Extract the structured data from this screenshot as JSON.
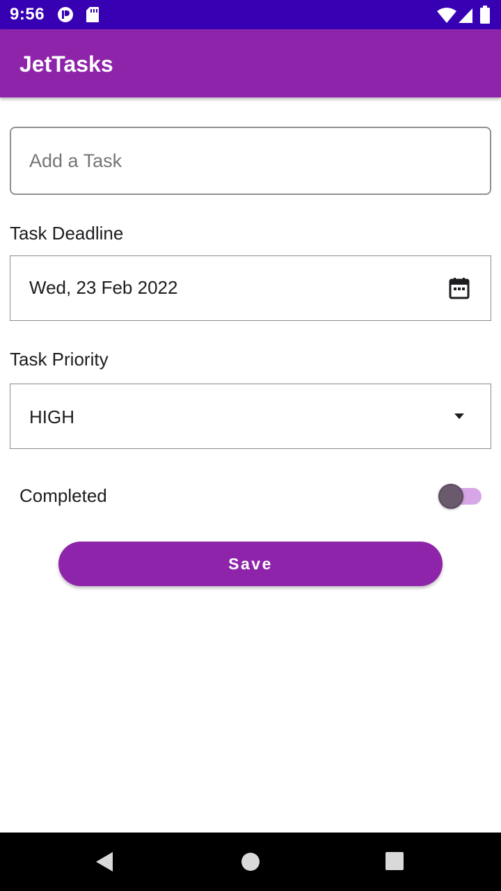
{
  "status_bar": {
    "time": "9:56",
    "left_icons": [
      "privacy-indicator-icon",
      "sd-card-icon"
    ],
    "right_icons": [
      "wifi-icon",
      "cell-signal-icon",
      "battery-icon"
    ]
  },
  "app_bar": {
    "title": "JetTasks"
  },
  "task_input": {
    "placeholder": "Add a Task",
    "value": ""
  },
  "deadline": {
    "label": "Task Deadline",
    "value": "Wed, 23 Feb 2022",
    "icon": "calendar-icon"
  },
  "priority": {
    "label": "Task Priority",
    "value": "HIGH",
    "icon": "dropdown-arrow-icon"
  },
  "completed": {
    "label": "Completed",
    "checked": false
  },
  "save_button": {
    "label": "Save"
  },
  "nav_bar": {
    "buttons": [
      "back-icon",
      "home-icon",
      "recents-icon"
    ]
  },
  "colors": {
    "status_bar": "#3700b3",
    "primary": "#8e24aa",
    "switch_track": "#d7a6e6",
    "switch_thumb": "#6b5a6e"
  }
}
